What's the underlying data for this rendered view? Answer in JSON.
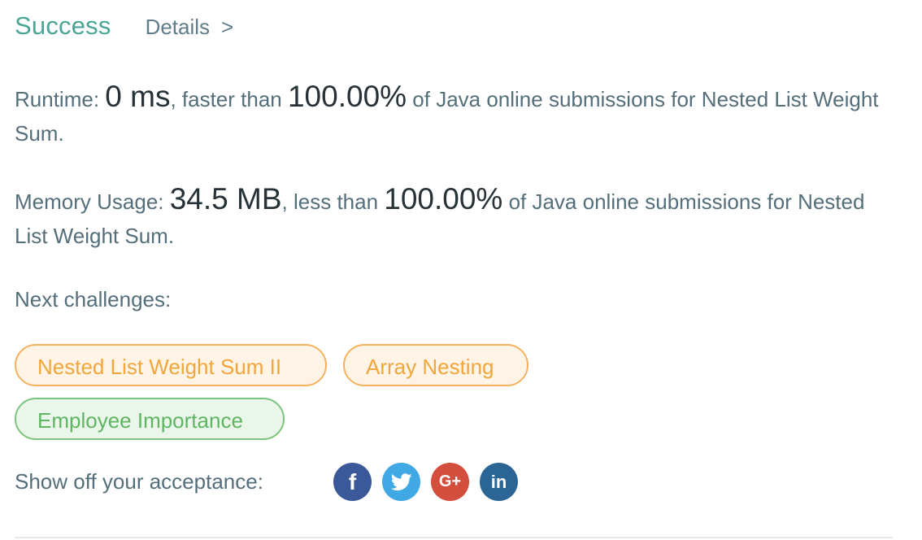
{
  "header": {
    "status": "Success",
    "details_label": "Details",
    "chevron": ">"
  },
  "runtime": {
    "label": "Runtime: ",
    "value": "0 ms",
    "comparison": ", faster than ",
    "percent": "100.00%",
    "suffix": " of Java online submissions for Nested List Weight Sum."
  },
  "memory": {
    "label": "Memory Usage: ",
    "value": "34.5 MB",
    "comparison": ", less than ",
    "percent": "100.00%",
    "suffix": " of Java online submissions for Nested List Weight Sum."
  },
  "next_challenges": {
    "label": "Next challenges:",
    "items": [
      {
        "title": "Nested List Weight Sum II",
        "difficulty_color": "#f0a63c"
      },
      {
        "title": "Array Nesting",
        "difficulty_color": "#f0a63c"
      },
      {
        "title": "Employee Importance",
        "difficulty_color": "#5fb562"
      }
    ]
  },
  "share": {
    "label": "Show off your acceptance:",
    "buttons": [
      {
        "icon": "facebook-icon",
        "glyph": "f",
        "color": "#3b5998"
      },
      {
        "icon": "twitter-icon",
        "color": "#41a8e6"
      },
      {
        "icon": "google-plus-icon",
        "glyph": "G+",
        "color": "#d34e3c"
      },
      {
        "icon": "linkedin-icon",
        "glyph": "in",
        "color": "#2a6595"
      }
    ]
  }
}
